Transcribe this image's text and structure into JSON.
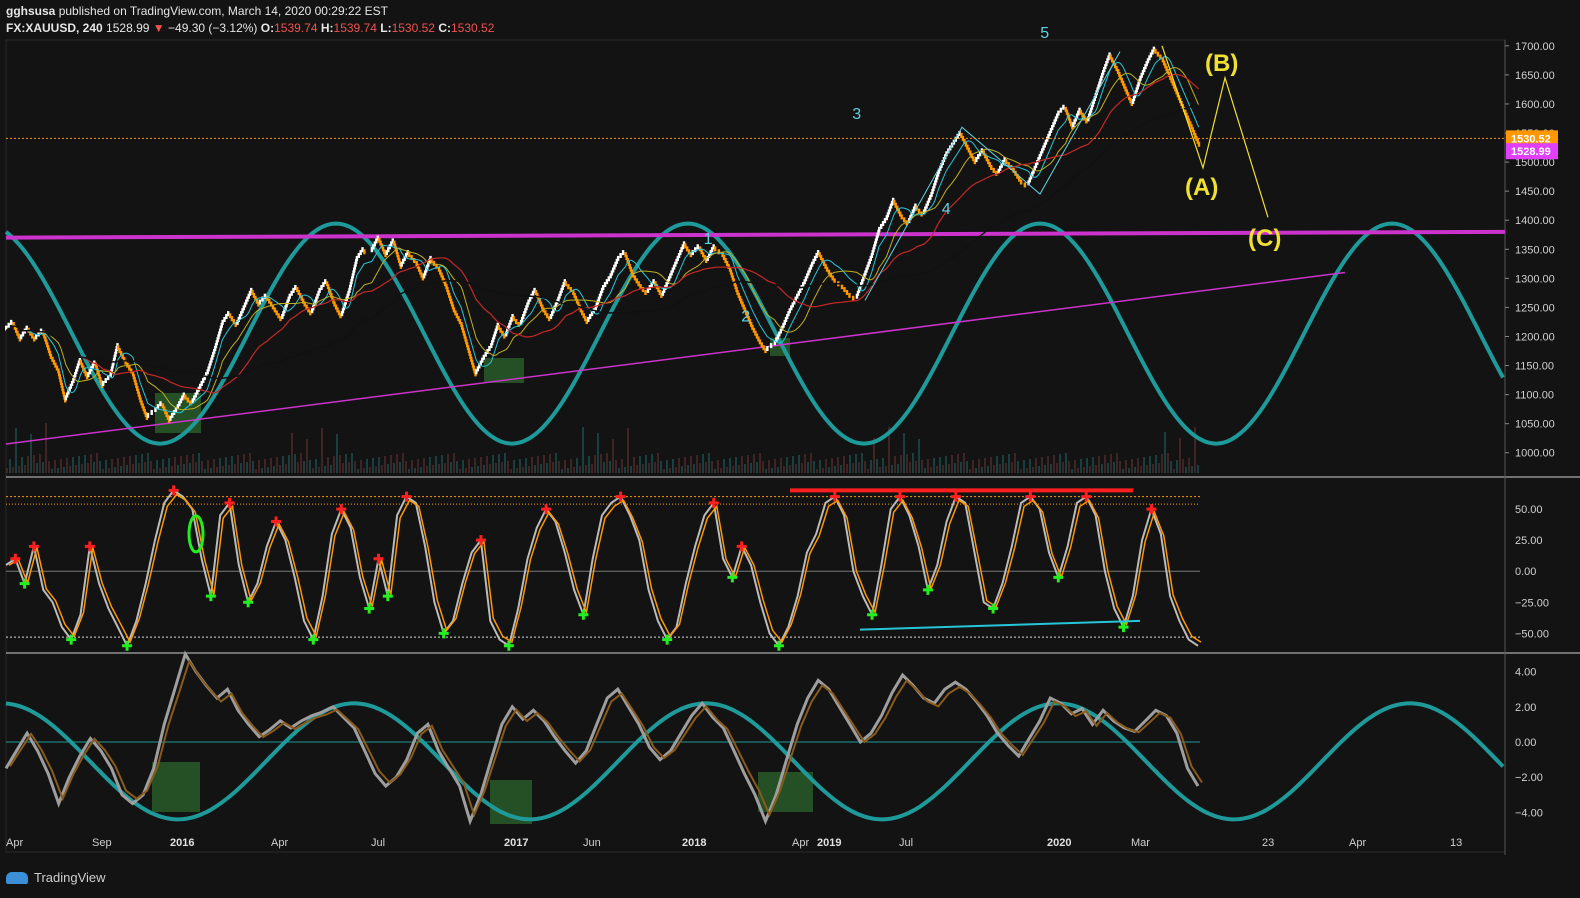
{
  "header": {
    "author": "gghsusa",
    "published": "published on TradingView.com, March 14, 2020 00:29:22 EST",
    "symbol": "FX:XAUUSD, 240",
    "last": "1528.99",
    "change": "−49.30 (−3.12%)",
    "o_label": "O:",
    "o": "1539.74",
    "h_label": "H:",
    "h": "1539.74",
    "l_label": "L:",
    "l": "1530.52",
    "c_label": "C:",
    "c": "1530.52"
  },
  "footer": {
    "brand": "TradingView",
    "logo": "tradingview-cloud-icon"
  },
  "colors": {
    "background": "#131313",
    "bull_brick": "#ffffff",
    "bear_brick": "#ff9800",
    "cycle": "#1f9a9a",
    "trendline": "#cc33cc",
    "wave_count": "#5fd3e0",
    "abc_labels": "#f0e030",
    "sell_marker": "#ff1f1f",
    "buy_marker": "#22ee22"
  },
  "chart_data": [
    {
      "type": "renko",
      "panel": "price",
      "y_ticks": [
        "1700.00",
        "1650.00",
        "1600.00",
        "1550.00",
        "1500.00",
        "1450.00",
        "1400.00",
        "1350.00",
        "1300.00",
        "1250.00",
        "1200.00",
        "1150.00",
        "1100.00",
        "1050.00",
        "1000.00"
      ],
      "ylim": [
        960,
        1710
      ],
      "price_tags": [
        {
          "label": "1530.52",
          "value": 1530.52,
          "color": "#ff9800"
        },
        {
          "label": "1528.99",
          "value": 1528.99,
          "color": "#e040fb"
        }
      ],
      "path": [
        1210,
        1225,
        1195,
        1215,
        1195,
        1210,
        1170,
        1145,
        1090,
        1120,
        1160,
        1130,
        1155,
        1115,
        1130,
        1185,
        1160,
        1140,
        1095,
        1060,
        1070,
        1085,
        1055,
        1075,
        1100,
        1085,
        1110,
        1135,
        1175,
        1220,
        1240,
        1220,
        1250,
        1280,
        1255,
        1270,
        1250,
        1230,
        1265,
        1285,
        1260,
        1240,
        1275,
        1295,
        1260,
        1235,
        1275,
        1330,
        1350,
        1345,
        1370,
        1340,
        1365,
        1320,
        1345,
        1330,
        1300,
        1335,
        1320,
        1290,
        1250,
        1225,
        1180,
        1135,
        1160,
        1180,
        1220,
        1200,
        1235,
        1220,
        1255,
        1280,
        1250,
        1230,
        1260,
        1295,
        1280,
        1250,
        1225,
        1245,
        1280,
        1300,
        1330,
        1345,
        1310,
        1290,
        1275,
        1295,
        1270,
        1300,
        1330,
        1360,
        1340,
        1355,
        1330,
        1355,
        1345,
        1320,
        1280,
        1250,
        1220,
        1195,
        1175,
        1185,
        1210,
        1240,
        1265,
        1290,
        1320,
        1345,
        1320,
        1300,
        1290,
        1275,
        1265,
        1300,
        1335,
        1380,
        1400,
        1435,
        1410,
        1395,
        1425,
        1410,
        1440,
        1480,
        1510,
        1530,
        1550,
        1525,
        1500,
        1520,
        1495,
        1480,
        1505,
        1490,
        1470,
        1460,
        1490,
        1520,
        1550,
        1580,
        1595,
        1560,
        1590,
        1570,
        1610,
        1650,
        1685,
        1660,
        1630,
        1600,
        1640,
        1670,
        1695,
        1680,
        1650,
        1620,
        1590,
        1560,
        1530
      ],
      "annotations": {
        "waves": [
          "1",
          "2",
          "3",
          "4",
          "5"
        ],
        "corrective": [
          "(A)",
          "(B)",
          "(C)"
        ],
        "wave_points": [
          {
            "label": "1",
            "x_pct": 0.557,
            "value": 1345
          },
          {
            "label": "2",
            "x_pct": 0.578,
            "value": 1260
          },
          {
            "label": "3",
            "x_pct": 0.64,
            "value": 1560
          },
          {
            "label": "4",
            "x_pct": 0.69,
            "value": 1445
          },
          {
            "label": "5",
            "x_pct": 0.745,
            "value": 1700
          }
        ],
        "abc_path": [
          {
            "label": "(A)",
            "value": 1490
          },
          {
            "label": "(B)",
            "value": 1645
          },
          {
            "label": "(C)",
            "value": 1405
          }
        ]
      },
      "horizontal_resistance": 1375,
      "rising_trendline": [
        1015,
        1310
      ]
    },
    {
      "type": "line",
      "panel": "oscillator",
      "name": "stochastic",
      "y_ticks": [
        "50.00",
        "25.00",
        "0.00",
        "−25.00",
        "−50.00"
      ],
      "ylim": [
        -65,
        75
      ],
      "upper_band": 60,
      "lower_band": -53,
      "values": [
        5,
        10,
        -10,
        20,
        -15,
        -25,
        -45,
        -55,
        -35,
        20,
        -10,
        -30,
        -45,
        -60,
        -40,
        -10,
        25,
        55,
        65,
        60,
        50,
        10,
        -20,
        45,
        55,
        5,
        -25,
        -10,
        20,
        40,
        25,
        -5,
        -40,
        -55,
        -20,
        30,
        50,
        35,
        -5,
        -30,
        10,
        -20,
        45,
        60,
        55,
        20,
        -25,
        -50,
        -40,
        -10,
        15,
        25,
        -40,
        -55,
        -60,
        -30,
        10,
        35,
        50,
        40,
        15,
        -15,
        -35,
        10,
        45,
        55,
        60,
        45,
        25,
        -15,
        -40,
        -55,
        -45,
        -10,
        20,
        45,
        55,
        10,
        -5,
        20,
        5,
        -25,
        -50,
        -60,
        -45,
        -20,
        15,
        30,
        55,
        60,
        45,
        0,
        -20,
        -35,
        5,
        50,
        60,
        45,
        20,
        -15,
        5,
        40,
        60,
        55,
        15,
        -25,
        -30,
        -10,
        20,
        55,
        60,
        50,
        15,
        -5,
        20,
        55,
        60,
        45,
        0,
        -30,
        -45,
        -20,
        25,
        50,
        30,
        -20,
        -40,
        -55,
        -60
      ]
    },
    {
      "type": "line",
      "panel": "momentum",
      "y_ticks": [
        "4.00",
        "2.00",
        "0.00",
        "−2.00",
        "−4.00"
      ],
      "ylim": [
        -5,
        5
      ],
      "values": [
        -1.5,
        -0.5,
        0.5,
        -0.5,
        -1.8,
        -3.5,
        -2,
        -0.8,
        0.2,
        -0.5,
        -1.5,
        -3,
        -3.5,
        -3,
        -1.5,
        1,
        3,
        5,
        4,
        3.2,
        2.5,
        3,
        1.8,
        1,
        0.3,
        0.7,
        1.2,
        0.8,
        1.2,
        1.5,
        1.7,
        2,
        1.4,
        0.8,
        -0.5,
        -1.8,
        -2.5,
        -2,
        -1,
        0.5,
        1,
        -0.5,
        -1.5,
        -2.5,
        -4.5,
        -3,
        -1,
        1,
        2,
        1.3,
        1.8,
        1.2,
        0.3,
        -0.5,
        -1.2,
        -0.5,
        1,
        2.5,
        3,
        2,
        1,
        -0.3,
        -1,
        -0.5,
        0.5,
        1.5,
        2.2,
        1.4,
        0.8,
        -0.5,
        -1.8,
        -3,
        -4.5,
        -3,
        -1,
        1,
        2.5,
        3.5,
        3,
        2,
        1,
        0,
        0.5,
        1.5,
        2.8,
        3.8,
        3.2,
        2.5,
        2.2,
        3,
        3.4,
        3,
        2.3,
        1.5,
        0.5,
        -0.2,
        -0.8,
        0.2,
        1.2,
        2.5,
        2.2,
        1.6,
        1.9,
        1,
        1.8,
        1.2,
        0.8,
        0.6,
        1.2,
        1.8,
        1.5,
        0.5,
        -1.5,
        -2.5
      ]
    }
  ],
  "x_axis": {
    "labels": [
      "Apr",
      "Sep",
      "2016",
      "Apr",
      "Jul",
      "2017",
      "Jun",
      "2018",
      "Apr",
      "2019",
      "Jul",
      "2020",
      "Mar",
      "23",
      "Apr",
      "13"
    ],
    "bold": [
      "2016",
      "2017",
      "2018",
      "2019",
      "2020"
    ]
  }
}
